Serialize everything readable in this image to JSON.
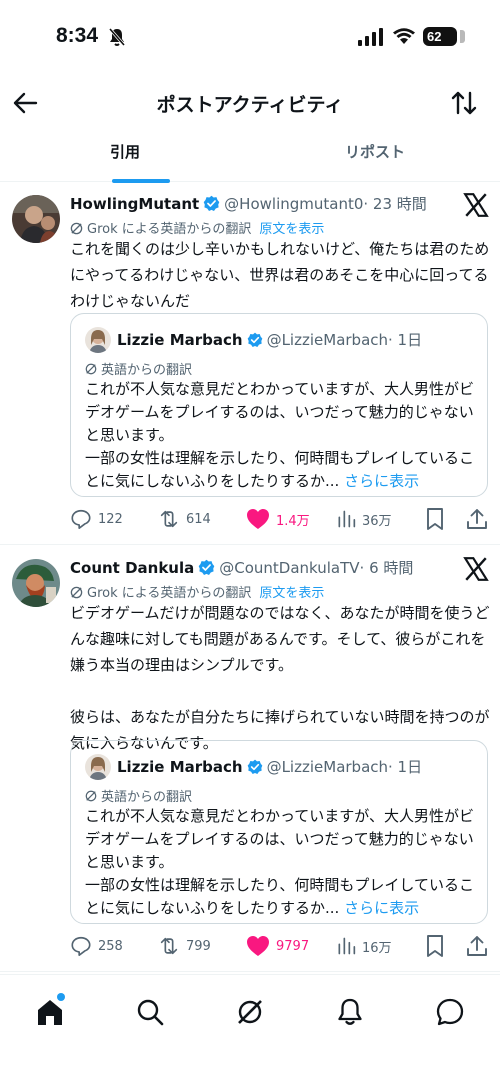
{
  "status": {
    "time": "8:34",
    "battery": "62"
  },
  "header": {
    "title": "ポストアクティビティ"
  },
  "tabs": [
    {
      "label": "引用"
    },
    {
      "label": "リポスト"
    }
  ],
  "posts": [
    {
      "name": "HowlingMutant",
      "handle": "@Howlingmutant0",
      "time": "· 23 時間",
      "translation": "Grok による英語からの翻訳",
      "show_original": "原文を表示",
      "text": "これを聞くのは少し辛いかもしれないけど、俺たちは君のためにやってるわけじゃない、世界は君のあそこを中心に回ってるわけじゃないんだ",
      "quote": {
        "name": "Lizzie Marbach",
        "handle": "@LizzieMarbach",
        "time": "· 1日",
        "translation": "英語からの翻訳",
        "text1": "これが不人気な意見だとわかっていますが、大人男性がビデオゲームをプレイするのは、いつだって魅力的じゃないと思います。",
        "text2": "一部の女性は理解を示したり、何時間もプレイしていることに気にしないふりをしたりするか...",
        "more": "さらに表示"
      },
      "stats": {
        "replies": "122",
        "reposts": "614",
        "likes": "1.4万",
        "views": "36万"
      }
    },
    {
      "name": "Count Dankula",
      "handle": "@CountDankulaTV",
      "time": "· 6 時間",
      "translation": "Grok による英語からの翻訳",
      "show_original": "原文を表示",
      "text": "ビデオゲームだけが問題なのではなく、あなたが時間を使うどんな趣味に対しても問題があるんです。そして、彼らがこれを嫌う本当の理由はシンプルです。",
      "text2": "彼らは、あなたが自分たちに捧げられていない時間を持つのが気に入らないんです。",
      "quote": {
        "name": "Lizzie Marbach",
        "handle": "@LizzieMarbach",
        "time": "· 1日",
        "translation": "英語からの翻訳",
        "text1": "これが不人気な意見だとわかっていますが、大人男性がビデオゲームをプレイするのは、いつだって魅力的じゃないと思います。",
        "text2": "一部の女性は理解を示したり、何時間もプレイしていることに気にしないふりをしたりするか...",
        "more": "さらに表示"
      },
      "stats": {
        "replies": "258",
        "reposts": "799",
        "likes": "9797",
        "views": "16万"
      }
    }
  ],
  "colors": {
    "accent": "#1d9bf0",
    "like": "#f91880",
    "muted": "#536471"
  },
  "nav": [
    "home-icon",
    "search-icon",
    "grok-icon",
    "notifications-icon",
    "messages-icon"
  ]
}
